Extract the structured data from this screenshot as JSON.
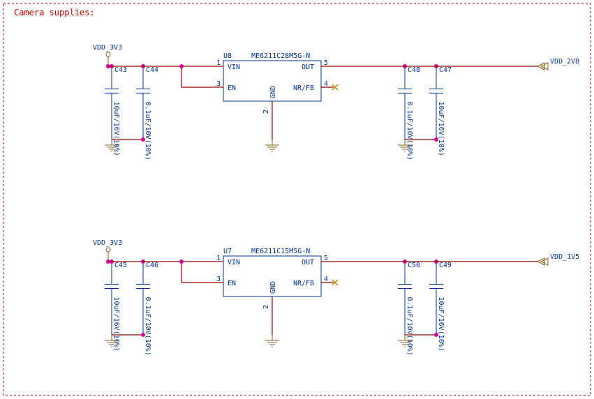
{
  "title": "Camera supplies:",
  "regulators": [
    {
      "ref": "U8",
      "part": "ME6211C28M5G-N",
      "in_net": "VDD_3V3",
      "out_net": "VDD_2V8",
      "pins": {
        "vin": "1",
        "en": "3",
        "gnd": "2",
        "nrfb": "4",
        "out": "5"
      },
      "caps_in": [
        {
          "ref": "C43",
          "val": "10uF/16V(10%)"
        },
        {
          "ref": "C44",
          "val": "0.1uF/10V(10%)"
        }
      ],
      "caps_out": [
        {
          "ref": "C48",
          "val": "0.1uF/10V(10%)"
        },
        {
          "ref": "C47",
          "val": "10uF/16V(10%)"
        }
      ],
      "labels": {
        "vin": "VIN",
        "en": "EN",
        "gnd": "GND",
        "nrfb": "NR/FB",
        "out": "OUT"
      }
    },
    {
      "ref": "U7",
      "part": "ME6211C15M5G-N",
      "in_net": "VDD_3V3",
      "out_net": "VDD_1V5",
      "pins": {
        "vin": "1",
        "en": "3",
        "gnd": "2",
        "nrfb": "4",
        "out": "5"
      },
      "caps_in": [
        {
          "ref": "C45",
          "val": "10uF/16V(10%)"
        },
        {
          "ref": "C46",
          "val": "0.1uF/10V(10%)"
        }
      ],
      "caps_out": [
        {
          "ref": "C50",
          "val": "0.1uF/10V(10%)"
        },
        {
          "ref": "C49",
          "val": "10uF/16V(10%)"
        }
      ],
      "labels": {
        "vin": "VIN",
        "en": "EN",
        "gnd": "GND",
        "nrfb": "NR/FB",
        "out": "OUT"
      }
    }
  ]
}
